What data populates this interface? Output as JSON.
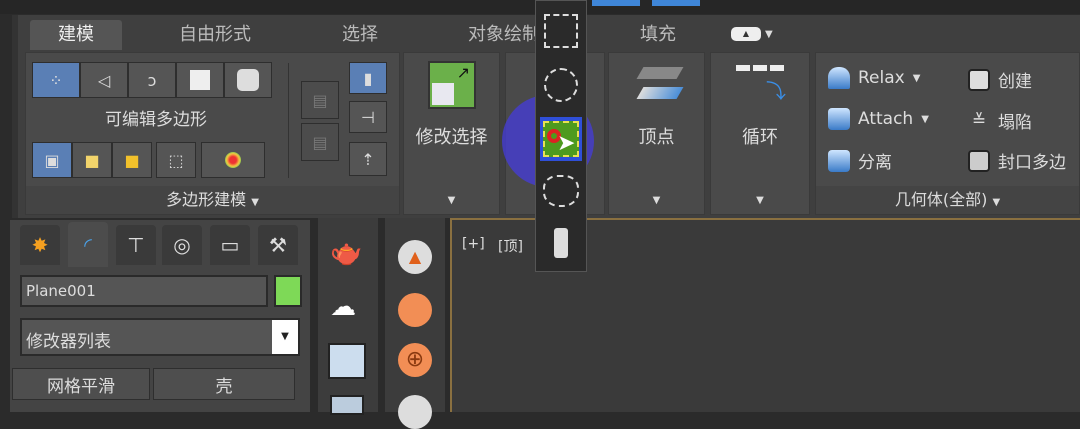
{
  "ribbon": {
    "tabs": [
      "建模",
      "自由形式",
      "选择",
      "对象绘制",
      "填充"
    ],
    "groups": {
      "poly_modeling": {
        "title": "可编辑多边形",
        "label": "多边形建模"
      },
      "modify_selection": {
        "label": "修改选择"
      },
      "vertex": {
        "label": "顶点"
      },
      "loop": {
        "label": "循环"
      },
      "geometry": {
        "label": "几何体(全部)",
        "items": [
          "Relax",
          "Attach",
          "分离",
          "创建",
          "塌陷",
          "封口多边"
        ]
      }
    }
  },
  "command_panel": {
    "object_name": "Plane001",
    "object_color": "#7ed957",
    "modifier_list": "修改器列表",
    "buttons": [
      "网格平滑",
      "壳"
    ]
  },
  "viewport": {
    "label_plus": "[+]",
    "label_view": "[顶]"
  },
  "colors": {
    "selection_blue": "#5a7fb5",
    "viewport_border": "#8a7040"
  }
}
